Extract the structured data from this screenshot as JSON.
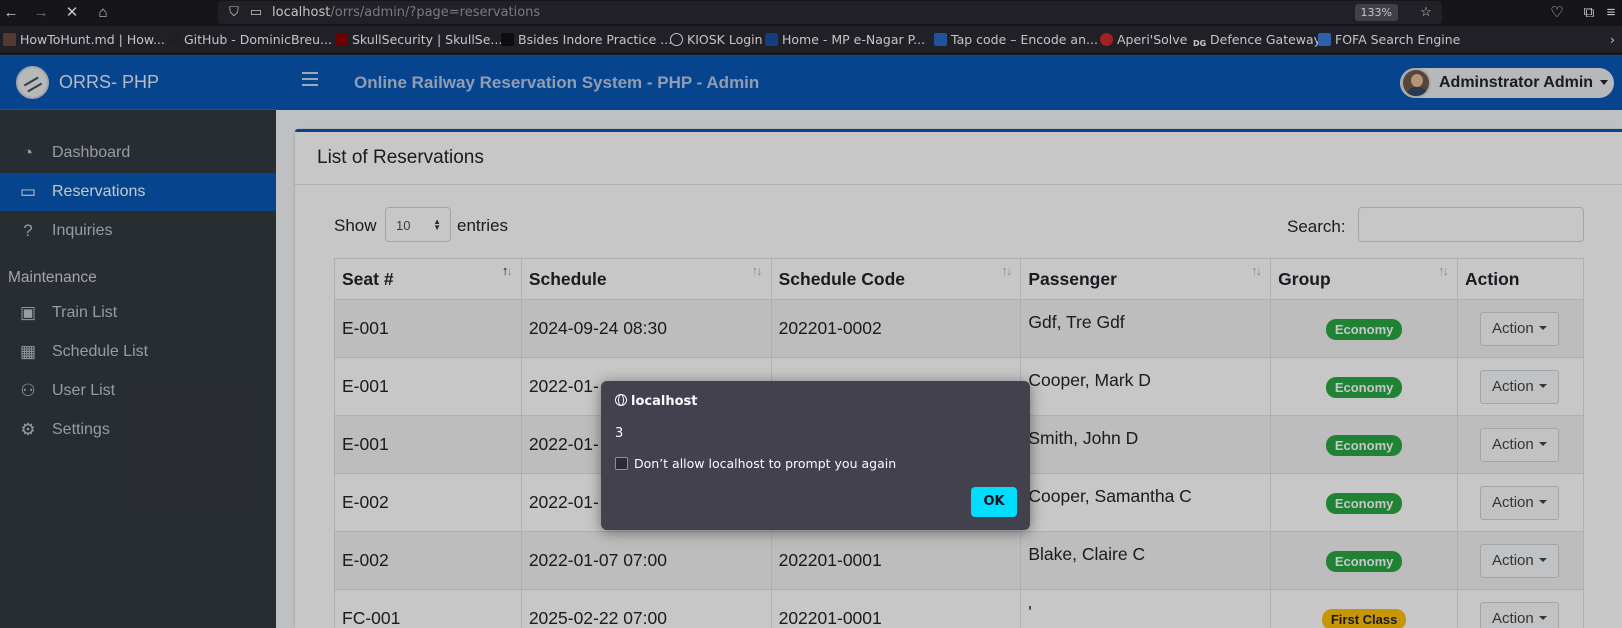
{
  "browser": {
    "url_host": "localhost",
    "url_path": "/orrs/admin/?page=reservations",
    "zoom": "133%",
    "bookmarks": [
      {
        "label": "HowToHunt.md | How...",
        "icon_color": "#6b4e3d"
      },
      {
        "label": "GitHub - DominicBreu...",
        "icon_color": "#24292e"
      },
      {
        "label": "SkullSecurity | SkullSe...",
        "icon_color": "#8b0000"
      },
      {
        "label": "Bsides Indore Practice ...",
        "icon_color": "#111111"
      },
      {
        "label": "KIOSK Login",
        "icon_color": "#2b2a33"
      },
      {
        "label": "Home - MP e-Nagar P...",
        "icon_color": "#1a4fa0"
      },
      {
        "label": "Tap code – Encode an...",
        "icon_color": "#2a6bc3"
      },
      {
        "label": "Aperi'Solve",
        "icon_color": "#d12b2b"
      },
      {
        "label": "Defence Gateway",
        "icon_color": "#2b2a33"
      },
      {
        "label": "FOFA Search Engine",
        "icon_color": "#3a7bd5"
      }
    ]
  },
  "app": {
    "brand": "ORRS- PHP",
    "title": "Online Railway Reservation System - PHP - Admin",
    "user": "Adminstrator Admin"
  },
  "sidebar": {
    "items": [
      {
        "label": "Dashboard",
        "icon": "dashboard-icon"
      },
      {
        "label": "Reservations",
        "icon": "ticket-icon"
      },
      {
        "label": "Inquiries",
        "icon": "question-icon"
      }
    ],
    "maintenance_header": "Maintenance",
    "maintenance_items": [
      {
        "label": "Train List",
        "icon": "train-icon"
      },
      {
        "label": "Schedule List",
        "icon": "calendar-icon"
      },
      {
        "label": "User List",
        "icon": "users-icon"
      },
      {
        "label": "Settings",
        "icon": "cogs-icon"
      }
    ]
  },
  "reservations": {
    "title": "List of Reservations",
    "show_label": "Show",
    "entries_value": "10",
    "entries_label": "entries",
    "search_label": "Search:",
    "columns": [
      "Seat #",
      "Schedule",
      "Schedule Code",
      "Passenger",
      "Group",
      "Action"
    ],
    "rows": [
      {
        "seat": "E-001",
        "schedule": "2024-09-24 08:30",
        "code": "202201-0002",
        "passenger": "Gdf, Tre Gdf",
        "group": "Economy",
        "action": "Action"
      },
      {
        "seat": "E-001",
        "schedule": "2022-01-",
        "code": "",
        "passenger": "Cooper, Mark D",
        "group": "Economy",
        "action": "Action"
      },
      {
        "seat": "E-001",
        "schedule": "2022-01-",
        "code": "",
        "passenger": "Smith, John D",
        "group": "Economy",
        "action": "Action"
      },
      {
        "seat": "E-002",
        "schedule": "2022-01-",
        "code": "",
        "passenger": "Cooper, Samantha C",
        "group": "Economy",
        "action": "Action"
      },
      {
        "seat": "E-002",
        "schedule": "2022-01-07 07:00",
        "code": "202201-0001",
        "passenger": "Blake, Claire C",
        "group": "Economy",
        "action": "Action"
      },
      {
        "seat": "FC-001",
        "schedule": "2025-02-22 07:00",
        "code": "202201-0001",
        "passenger": "'",
        "group": "First Class",
        "action": "Action"
      }
    ]
  },
  "dialog": {
    "origin": "localhost",
    "message": "3",
    "checkbox_label": "Don’t allow localhost to prompt you again",
    "ok_label": "OK"
  },
  "colors": {
    "primary": "#0a58b6",
    "sidebar": "#343a40",
    "economy_badge": "#28a745",
    "first_class_badge": "#ffc107",
    "dialog_ok": "#00ddff"
  }
}
